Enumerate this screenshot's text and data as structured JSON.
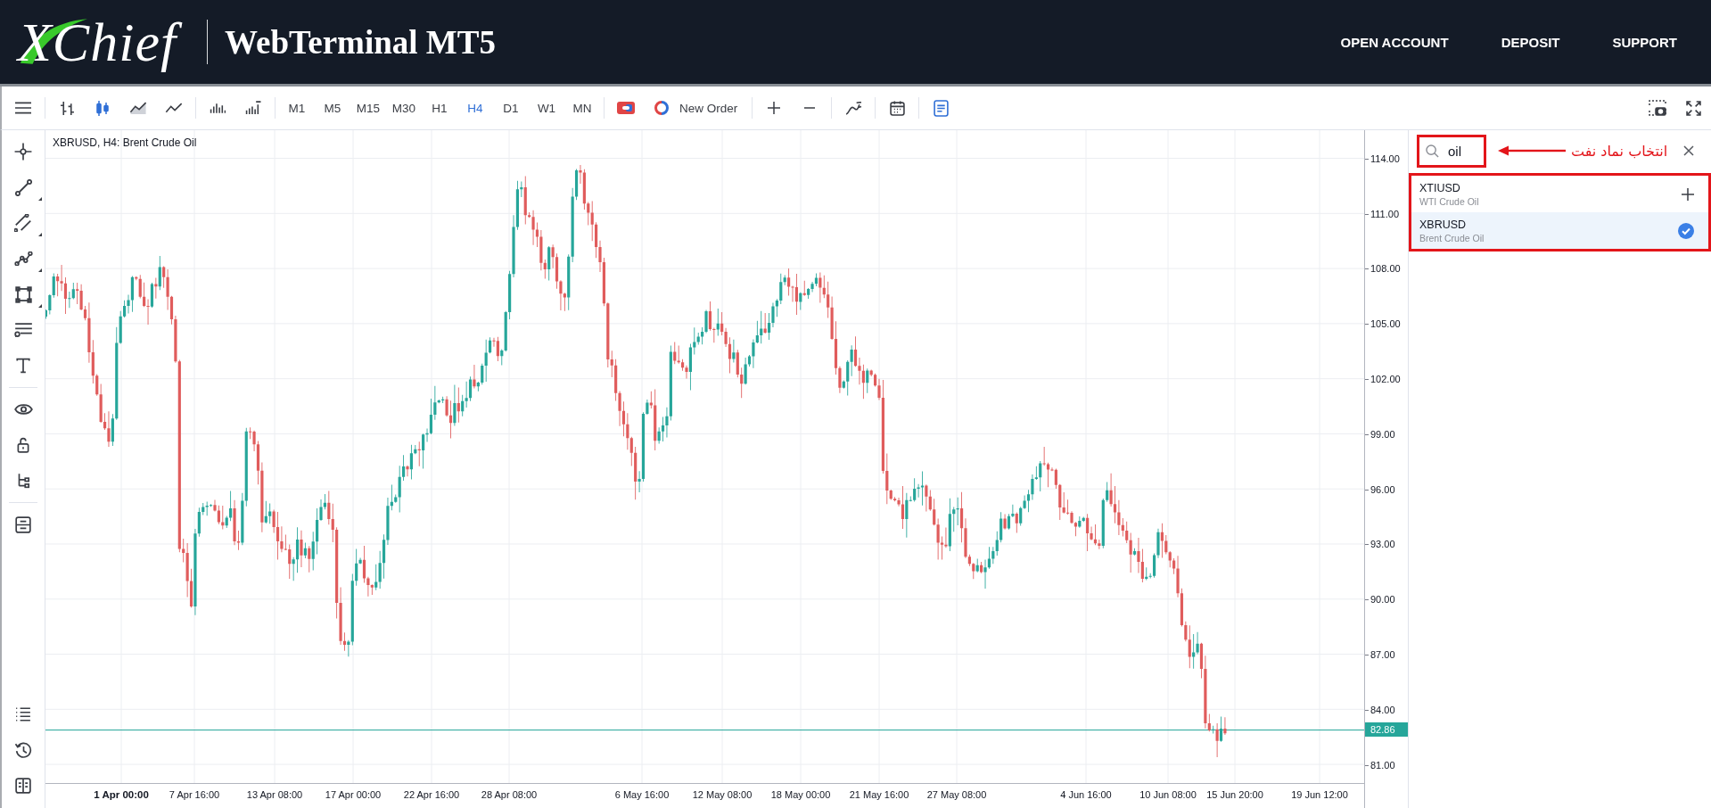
{
  "header": {
    "logo": "XChief",
    "title": "WebTerminal MT5",
    "nav": [
      {
        "label": "OPEN ACCOUNT"
      },
      {
        "label": "DEPOSIT"
      },
      {
        "label": "SUPPORT"
      }
    ]
  },
  "toolbar": {
    "chart_types": [
      {
        "kind": "bars",
        "selected": false
      },
      {
        "kind": "candles",
        "selected": true
      },
      {
        "kind": "area",
        "selected": false
      },
      {
        "kind": "line",
        "selected": false
      }
    ],
    "timeframes": [
      {
        "label": "M1",
        "selected": false
      },
      {
        "label": "M5",
        "selected": false
      },
      {
        "label": "M15",
        "selected": false
      },
      {
        "label": "M30",
        "selected": false
      },
      {
        "label": "H1",
        "selected": false
      },
      {
        "label": "H4",
        "selected": true
      },
      {
        "label": "D1",
        "selected": false
      },
      {
        "label": "W1",
        "selected": false
      },
      {
        "label": "MN",
        "selected": false
      }
    ],
    "new_order": {
      "label": "New Order"
    },
    "journal": {
      "on": true
    }
  },
  "chart": {
    "title": "XBRUSD, H4: Brent Crude Oil",
    "price_labels": [
      "114.00",
      "111.00",
      "108.00",
      "105.00",
      "102.00",
      "99.00",
      "96.00",
      "93.00",
      "90.00",
      "87.00",
      "84.00",
      "81.00"
    ],
    "current_price": "82.86",
    "time_labels": [
      {
        "label": "1 Apr 00:00",
        "major": true
      },
      {
        "label": "7 Apr 16:00",
        "major": false
      },
      {
        "label": "13 Apr 08:00",
        "major": false
      },
      {
        "label": "17 Apr 00:00",
        "major": false
      },
      {
        "label": "22 Apr 16:00",
        "major": false
      },
      {
        "label": "28 Apr 08:00",
        "major": false
      },
      {
        "label": "6 May 16:00",
        "major": false
      },
      {
        "label": "12 May 08:00",
        "major": false
      },
      {
        "label": "18 May 00:00",
        "major": false
      },
      {
        "label": "21 May 16:00",
        "major": false
      },
      {
        "label": "27 May 08:00",
        "major": false
      },
      {
        "label": "4 Jun 16:00",
        "major": false
      },
      {
        "label": "10 Jun 08:00",
        "major": false
      },
      {
        "label": "15 Jun 20:00",
        "major": false
      },
      {
        "label": "19 Jun 12:00",
        "major": false
      }
    ]
  },
  "symbol_search": {
    "query": "oil",
    "annotation": "انتخاب نماد نفت",
    "results": [
      {
        "symbol": "XTIUSD",
        "description": "WTI Crude Oil",
        "selected": false,
        "added": false
      },
      {
        "symbol": "XBRUSD",
        "description": "Brent Crude Oil",
        "selected": true,
        "added": true
      }
    ]
  }
}
